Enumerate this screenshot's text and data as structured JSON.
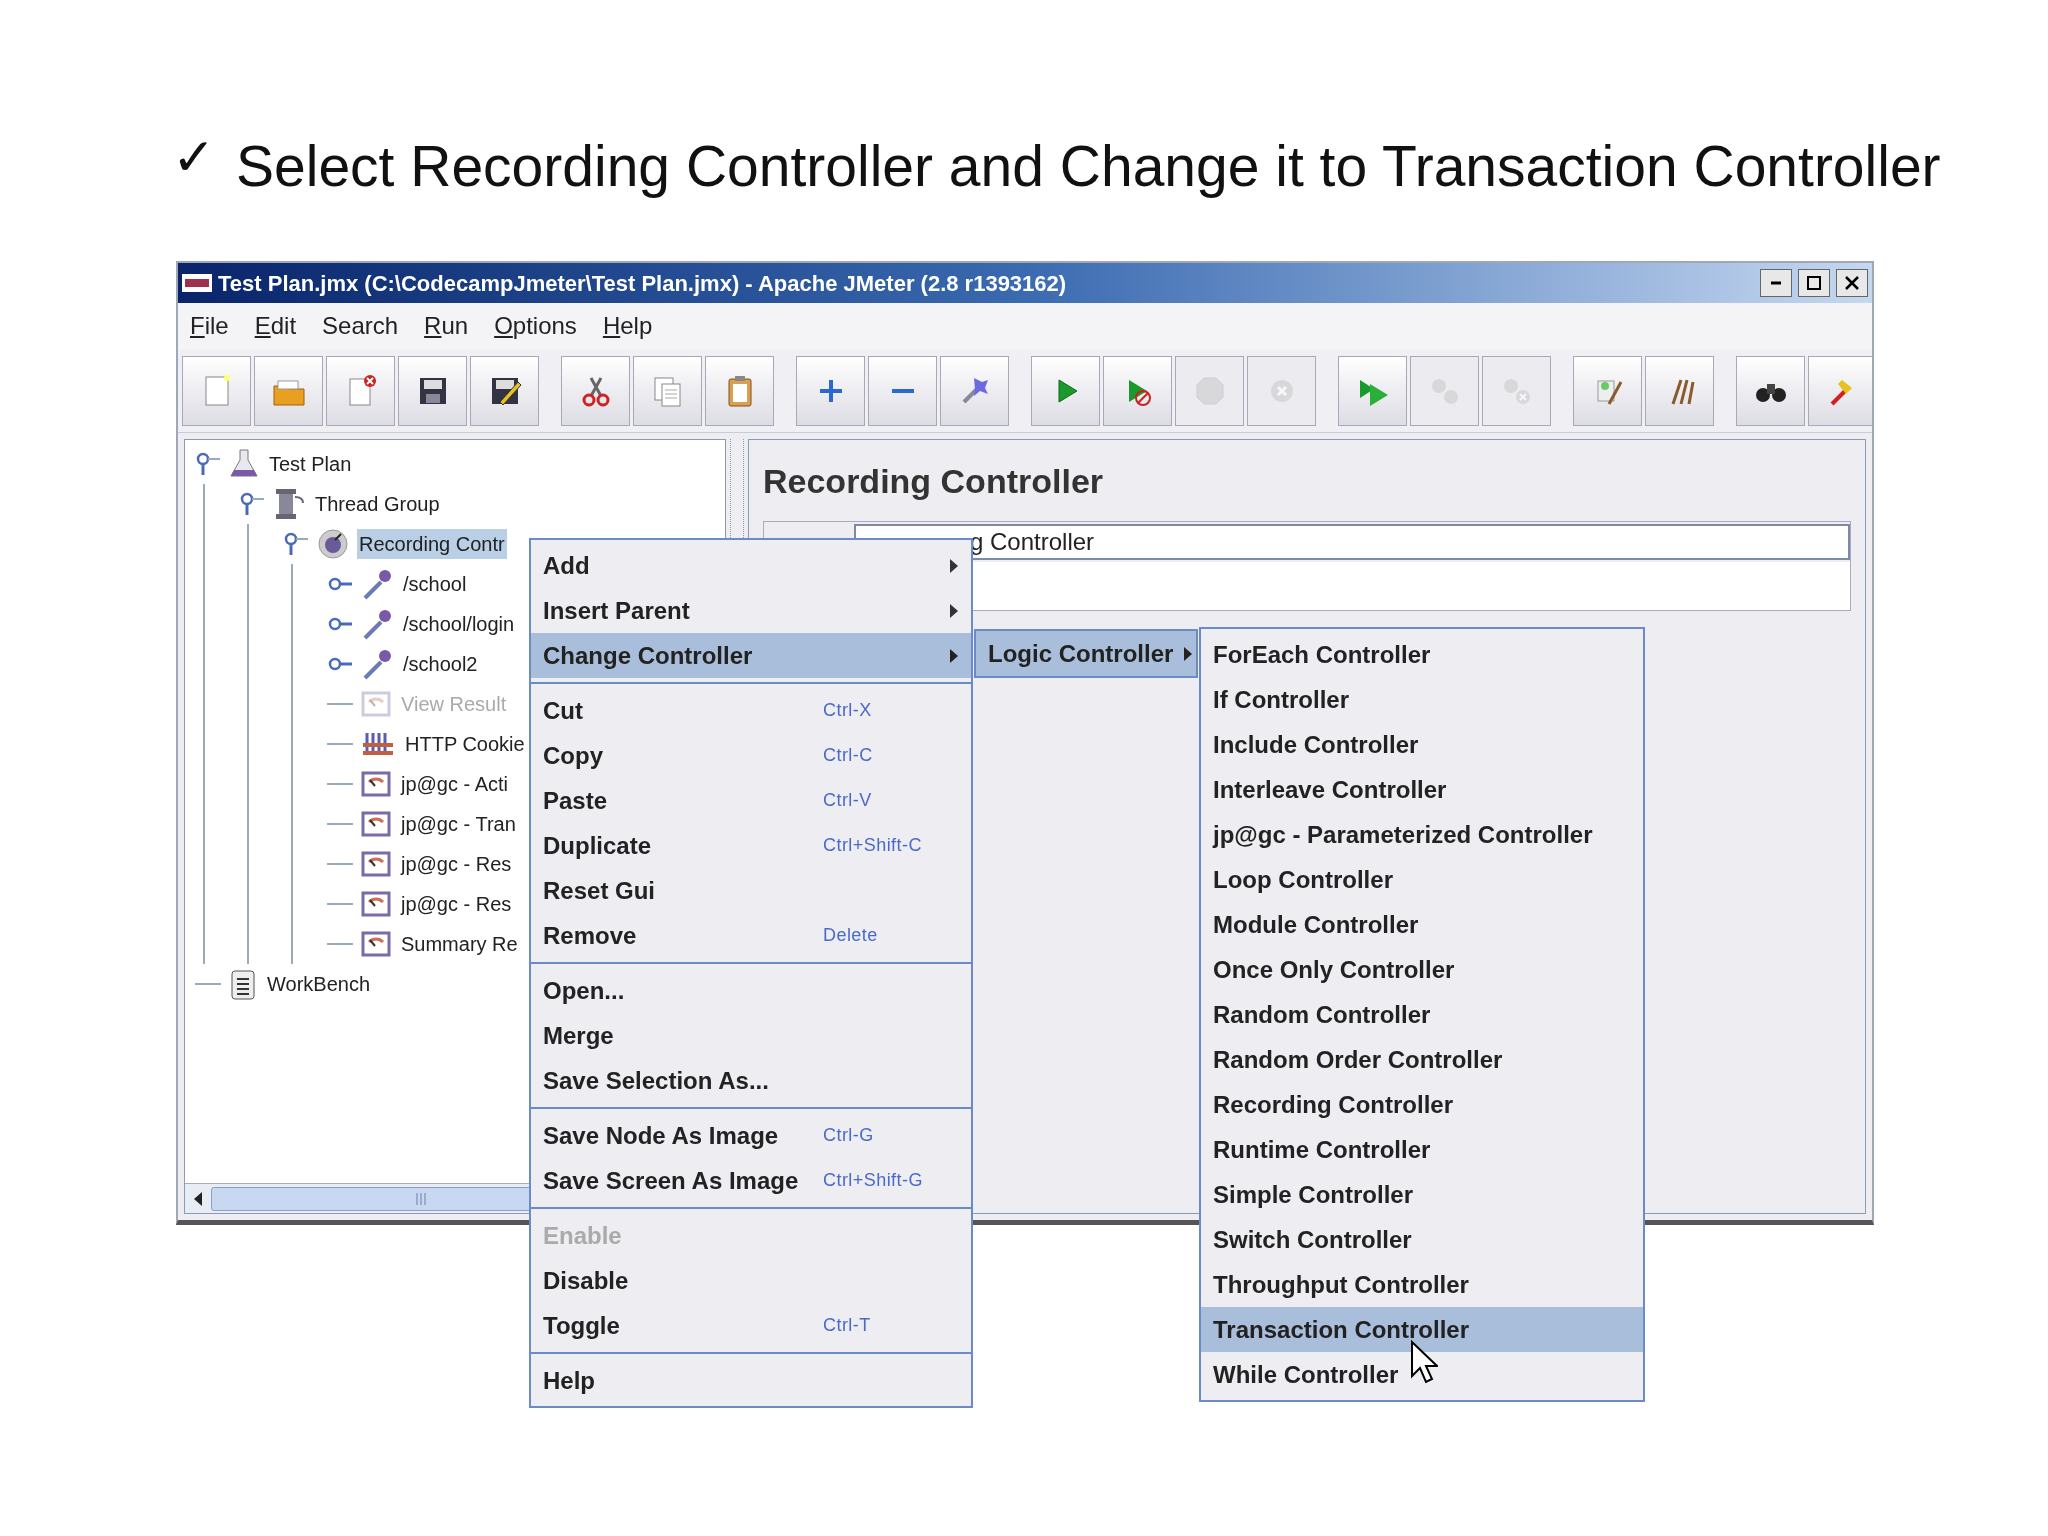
{
  "slide_heading": {
    "mark": "✓",
    "text": "Select Recording Controller and Change it to Transaction Controller"
  },
  "window": {
    "title": "Test Plan.jmx (C:\\CodecampJmeter\\Test Plan.jmx) - Apache JMeter (2.8 r1393162)"
  },
  "menu_bar": [
    {
      "label": "File",
      "mnemonic": true
    },
    {
      "label": "Edit",
      "mnemonic": true
    },
    {
      "label": "Search",
      "mnemonic": false
    },
    {
      "label": "Run",
      "mnemonic": true
    },
    {
      "label": "Options",
      "mnemonic": true
    },
    {
      "label": "Help",
      "mnemonic": true
    }
  ],
  "toolbar": [
    {
      "buttons": [
        {
          "disabled": false
        },
        {
          "disabled": false
        },
        {
          "disabled": false
        },
        {
          "disabled": false
        },
        {
          "disabled": false
        }
      ]
    },
    {
      "buttons": [
        {
          "disabled": false
        },
        {
          "disabled": false
        },
        {
          "disabled": false
        }
      ]
    },
    {
      "buttons": [
        {
          "disabled": false
        },
        {
          "disabled": false
        },
        {
          "disabled": false
        }
      ]
    },
    {
      "buttons": [
        {
          "disabled": false
        },
        {
          "disabled": false
        },
        {
          "disabled": true
        },
        {
          "disabled": true
        }
      ]
    },
    {
      "buttons": [
        {
          "disabled": false
        },
        {
          "disabled": true
        },
        {
          "disabled": true
        }
      ]
    },
    {
      "buttons": [
        {
          "disabled": false
        },
        {
          "disabled": false
        }
      ]
    },
    {
      "buttons": [
        {
          "disabled": false
        },
        {
          "disabled": false
        }
      ]
    }
  ],
  "tree": [
    {
      "label": "Test Plan",
      "kind": "test_plan",
      "expanded": true,
      "selected": false,
      "disabled": false,
      "children": [
        {
          "label": "Thread Group",
          "kind": "thread_group",
          "expanded": true,
          "selected": false,
          "disabled": false,
          "children": [
            {
              "label": "Recording Contr",
              "kind": "controller",
              "expanded": true,
              "selected": true,
              "disabled": false,
              "children": [
                {
                  "label": "/school",
                  "kind": "sampler",
                  "expanded": false,
                  "selected": false,
                  "disabled": false
                },
                {
                  "label": "/school/login",
                  "kind": "sampler",
                  "expanded": false,
                  "selected": false,
                  "disabled": false
                },
                {
                  "label": "/school2",
                  "kind": "sampler",
                  "expanded": false,
                  "selected": false,
                  "disabled": false
                },
                {
                  "label": "View Result",
                  "kind": "listener",
                  "selected": false,
                  "disabled": true
                },
                {
                  "label": "HTTP Cookie",
                  "kind": "config",
                  "selected": false,
                  "disabled": false
                },
                {
                  "label": "jp@gc - Acti",
                  "kind": "listener",
                  "selected": false,
                  "disabled": false
                },
                {
                  "label": "jp@gc - Tran",
                  "kind": "listener",
                  "selected": false,
                  "disabled": false
                },
                {
                  "label": "jp@gc - Res",
                  "kind": "listener",
                  "selected": false,
                  "disabled": false
                },
                {
                  "label": "jp@gc - Res",
                  "kind": "listener",
                  "selected": false,
                  "disabled": false
                },
                {
                  "label": "Summary Re",
                  "kind": "listener",
                  "selected": false,
                  "disabled": false
                }
              ]
            }
          ]
        }
      ]
    },
    {
      "label": "WorkBench",
      "kind": "workbench",
      "selected": false,
      "disabled": false
    }
  ],
  "editor": {
    "title": "Recording Controller",
    "name_value": "g Controller"
  },
  "context_menu": [
    [
      {
        "label": "Add",
        "kind": "submenu",
        "selected": false,
        "disabled": false
      },
      {
        "label": "Insert Parent",
        "kind": "submenu",
        "selected": false,
        "disabled": false
      },
      {
        "label": "Change Controller",
        "kind": "submenu",
        "selected": true,
        "disabled": false
      }
    ],
    [
      {
        "label": "Cut",
        "kind": "item",
        "shortcut": "Ctrl-X",
        "selected": false,
        "disabled": false
      },
      {
        "label": "Copy",
        "kind": "item",
        "shortcut": "Ctrl-C",
        "selected": false,
        "disabled": false
      },
      {
        "label": "Paste",
        "kind": "item",
        "shortcut": "Ctrl-V",
        "selected": false,
        "disabled": false
      },
      {
        "label": "Duplicate",
        "kind": "item",
        "shortcut": "Ctrl+Shift-C",
        "selected": false,
        "disabled": false
      },
      {
        "label": "Reset Gui",
        "kind": "item",
        "selected": false,
        "disabled": false
      },
      {
        "label": "Remove",
        "kind": "item",
        "shortcut": "Delete",
        "selected": false,
        "disabled": false
      }
    ],
    [
      {
        "label": "Open...",
        "kind": "item",
        "selected": false,
        "disabled": false
      },
      {
        "label": "Merge",
        "kind": "item",
        "selected": false,
        "disabled": false
      },
      {
        "label": "Save Selection As...",
        "kind": "item",
        "selected": false,
        "disabled": false
      }
    ],
    [
      {
        "label": "Save Node As Image",
        "kind": "item",
        "shortcut": "Ctrl-G",
        "selected": false,
        "disabled": false
      },
      {
        "label": "Save Screen As Image",
        "kind": "item",
        "shortcut": "Ctrl+Shift-G",
        "selected": false,
        "disabled": false
      }
    ],
    [
      {
        "label": "Enable",
        "kind": "item",
        "selected": false,
        "disabled": true
      },
      {
        "label": "Disable",
        "kind": "item",
        "selected": false,
        "disabled": false
      },
      {
        "label": "Toggle",
        "kind": "item",
        "shortcut": "Ctrl-T",
        "selected": false,
        "disabled": false
      }
    ],
    [
      {
        "label": "Help",
        "kind": "item",
        "selected": false,
        "disabled": false
      }
    ]
  ],
  "change_submenu": [
    {
      "label": "Logic Controller",
      "kind": "submenu",
      "selected": true,
      "disabled": false
    }
  ],
  "logic_submenu": [
    {
      "label": "ForEach Controller",
      "selected": false
    },
    {
      "label": "If Controller",
      "selected": false
    },
    {
      "label": "Include Controller",
      "selected": false
    },
    {
      "label": "Interleave Controller",
      "selected": false
    },
    {
      "label": "jp@gc - Parameterized Controller",
      "selected": false
    },
    {
      "label": "Loop Controller",
      "selected": false
    },
    {
      "label": "Module Controller",
      "selected": false
    },
    {
      "label": "Once Only Controller",
      "selected": false
    },
    {
      "label": "Random Controller",
      "selected": false
    },
    {
      "label": "Random Order Controller",
      "selected": false
    },
    {
      "label": "Recording Controller",
      "selected": false
    },
    {
      "label": "Runtime Controller",
      "selected": false
    },
    {
      "label": "Simple Controller",
      "selected": false
    },
    {
      "label": "Switch Controller",
      "selected": false
    },
    {
      "label": "Throughput Controller",
      "selected": false
    },
    {
      "label": "Transaction Controller",
      "selected": true
    },
    {
      "label": "While Controller",
      "selected": false
    }
  ]
}
